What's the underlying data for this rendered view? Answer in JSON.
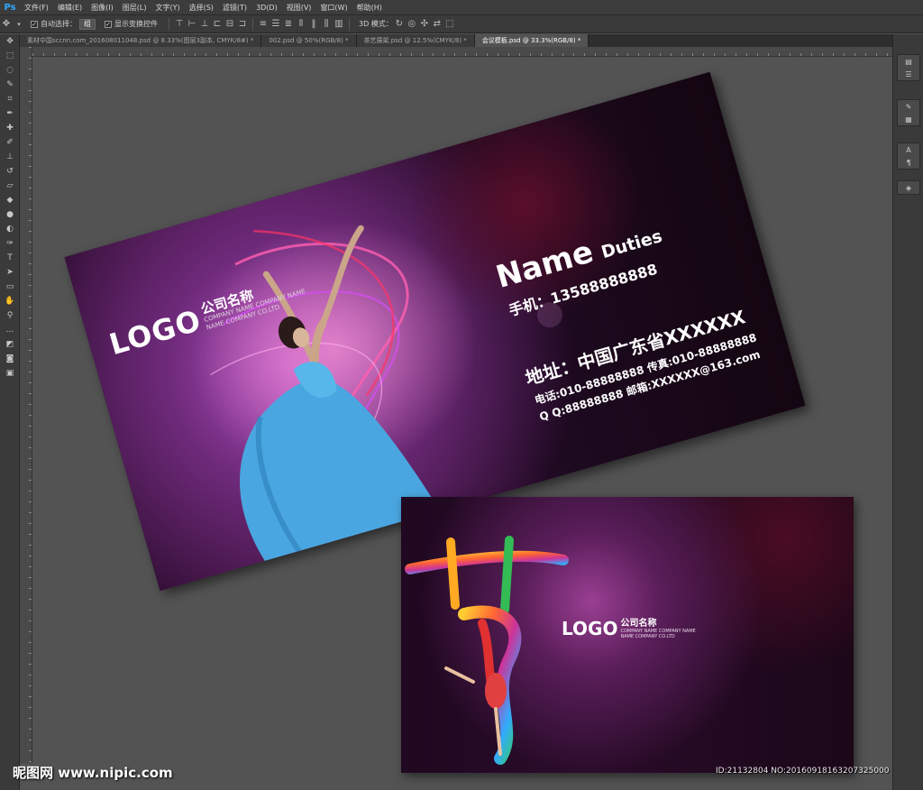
{
  "app": {
    "logo": "Ps",
    "menu": [
      "文件(F)",
      "编辑(E)",
      "图像(I)",
      "图层(L)",
      "文字(Y)",
      "选择(S)",
      "滤镜(T)",
      "3D(D)",
      "视图(V)",
      "窗口(W)",
      "帮助(H)"
    ]
  },
  "options": {
    "auto_select_label": "自动选择：",
    "auto_select_value": "组",
    "show_transform_label": "显示变换控件",
    "mode_3d_label": "3D 模式："
  },
  "tabs": [
    {
      "label": "素材中国sccnn.com_20160801104​8.psd @ 8.33%(图层3副本, CMYK/8#) *",
      "active": false
    },
    {
      "label": "002.psd @ 50%(RGB/8) *",
      "active": false
    },
    {
      "label": "茶艺展架.psd @ 12.5%(CMYK/8) *",
      "active": false
    },
    {
      "label": "会议模板.psd @ 33.3%(RGB/8) *",
      "active": true
    }
  ],
  "card_front": {
    "logo": "LOGO",
    "company_name": "公司名称",
    "company_sub1": "COMPANY NAME COMPANY NAME",
    "company_sub2": "NAME COMPANY CO.LTD",
    "name": "Name",
    "duties": "Duties",
    "phone": "手机：13588888888",
    "address": "地址：中国广东省XXXXXX",
    "tel_fax": "电话:010-88888888  传真:010-88888888",
    "qq_email": "Q Q:88888888  邮箱:XXXXXX@163.com"
  },
  "card_back": {
    "logo": "LOGO",
    "company_name": "公司名称",
    "company_sub1": "COMPANY NAME COMPANY NAME",
    "company_sub2": "NAME COMPANY CO.LTD",
    "art_glyph": "艺"
  },
  "watermark": {
    "site": "昵图网 www.nipic.com",
    "id": "ID:21132804 NO:20160918163207325000"
  },
  "colors": {
    "ps_blue": "#31a8ff",
    "workspace": "#535353",
    "card_purple": "#3d0f3a",
    "dress_blue": "#4aa6e0"
  }
}
